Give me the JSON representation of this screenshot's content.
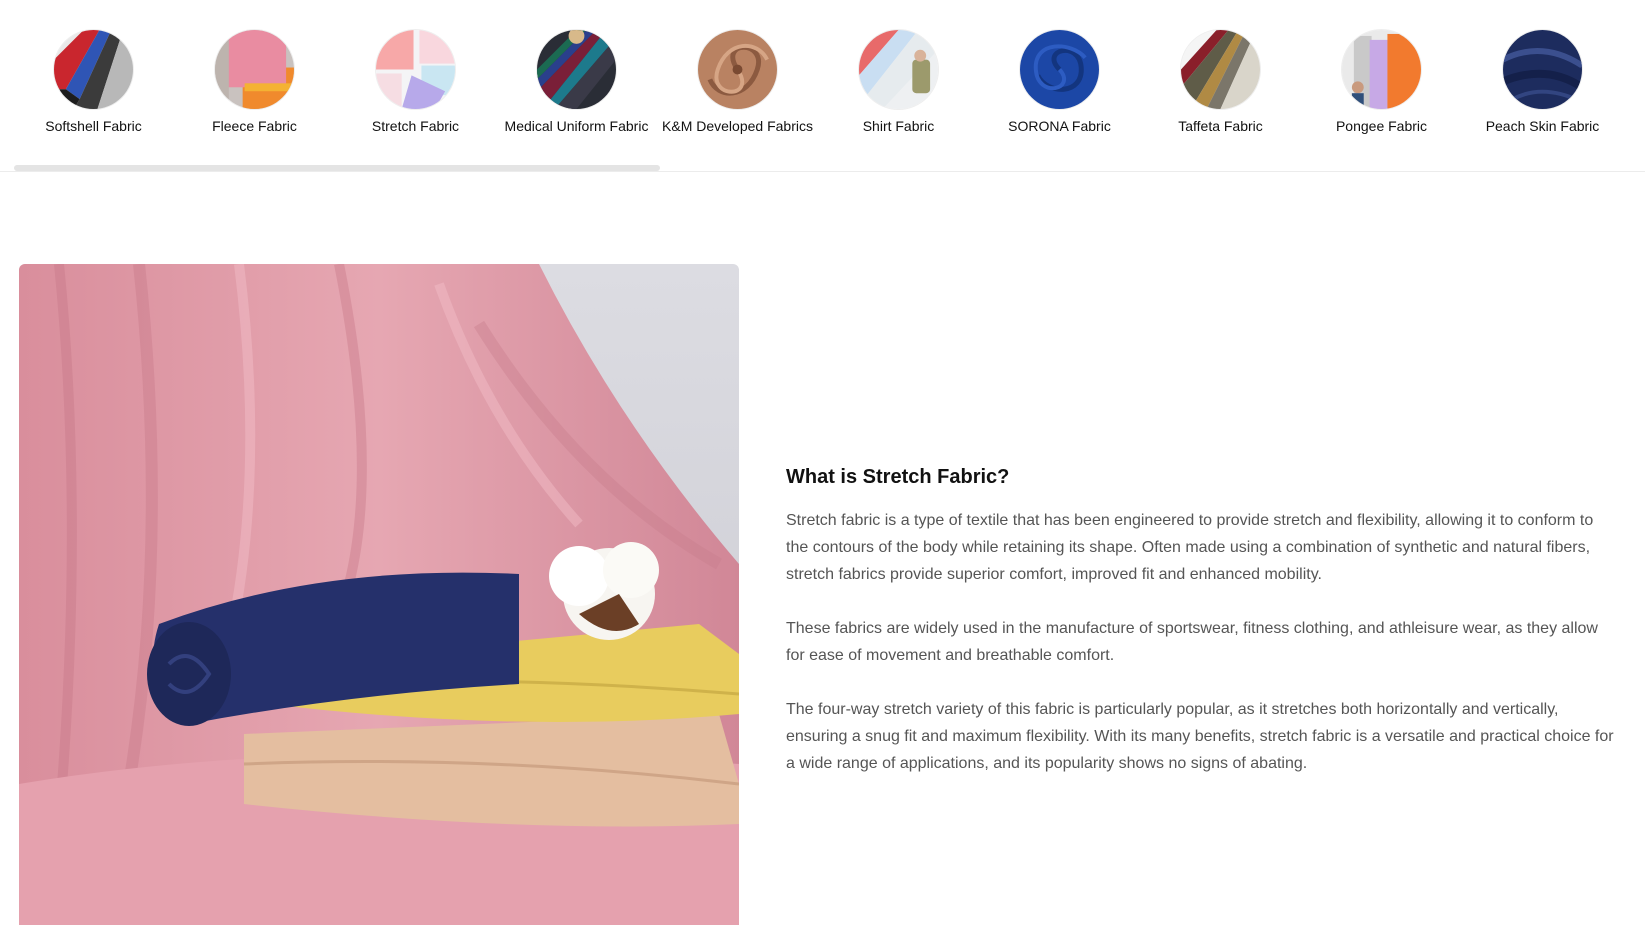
{
  "categories": [
    {
      "label": "Softshell Fabric",
      "icon": "softshell-fabric-swatch"
    },
    {
      "label": "Fleece Fabric",
      "icon": "fleece-fabric-swatch"
    },
    {
      "label": "Stretch Fabric",
      "icon": "stretch-fabric-swatch"
    },
    {
      "label": "Medical Uniform Fabric",
      "icon": "medical-uniform-fabric-swatch"
    },
    {
      "label": "K&M Developed Fabrics",
      "icon": "km-developed-fabric-swatch"
    },
    {
      "label": "Shirt Fabric",
      "icon": "shirt-fabric-swatch"
    },
    {
      "label": "SORONA Fabric",
      "icon": "sorona-fabric-swatch"
    },
    {
      "label": "Taffeta Fabric",
      "icon": "taffeta-fabric-swatch"
    },
    {
      "label": "Pongee Fabric",
      "icon": "pongee-fabric-swatch"
    },
    {
      "label": "Peach Skin Fabric",
      "icon": "peach-skin-fabric-swatch"
    }
  ],
  "article": {
    "title": "What is Stretch Fabric?",
    "paragraphs": [
      "Stretch fabric is a type of textile that has been engineered to provide stretch and flexibility, allowing it to conform to the contours of the body while retaining its shape. Often made using a combination of synthetic and natural fibers, stretch fabrics provide superior comfort, improved fit and enhanced mobility.",
      "These fabrics are widely used in the manufacture of sportswear, fitness clothing, and athleisure wear, as they allow for ease of movement and breathable comfort.",
      "The four-way stretch variety of this fabric is particularly popular, as it stretches both horizontally and vertically, ensuring a snug fit and maximum flexibility. With its many benefits, stretch fabric is a versatile and practical choice for a wide range of applications, and its popularity shows no signs of abating."
    ]
  },
  "hero_image": {
    "icon": "stretch-fabric-photo"
  },
  "scrollbar": {
    "thumb_fraction": 0.4
  },
  "colors": {
    "title": "#111111",
    "body_text": "#555555",
    "pink_fabric": "#dd9aa6",
    "navy_roll": "#25306b",
    "yellow_fold": "#e6c95a",
    "beige_fold": "#e6c1a3"
  }
}
